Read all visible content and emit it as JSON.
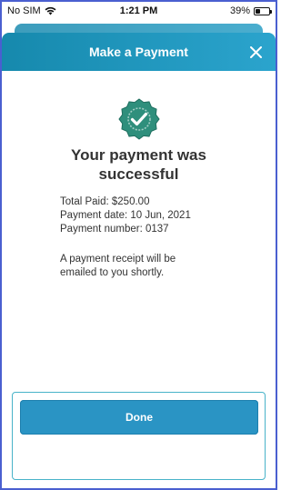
{
  "status_bar": {
    "carrier": "No SIM",
    "time": "1:21 PM",
    "battery": "39%",
    "battery_level": 0.39
  },
  "modal": {
    "title": "Make a Payment",
    "close_icon": "close-icon"
  },
  "success": {
    "icon": "verified-badge-icon",
    "headline_line1": "Your payment was",
    "headline_line2": "successful",
    "total_paid": "Total Paid: $250.00",
    "payment_date": "Payment date: 10 Jun, 2021",
    "payment_number": "Payment number: 0137",
    "note_line1": "A payment receipt will be",
    "note_line2": "emailed to you shortly."
  },
  "footer": {
    "done_label": "Done"
  },
  "colors": {
    "header_start": "#1689ad",
    "header_end": "#2ba4cd",
    "button": "#2a94c4",
    "seal": "#2f8f7c",
    "frame_border": "#4a5fd0"
  }
}
